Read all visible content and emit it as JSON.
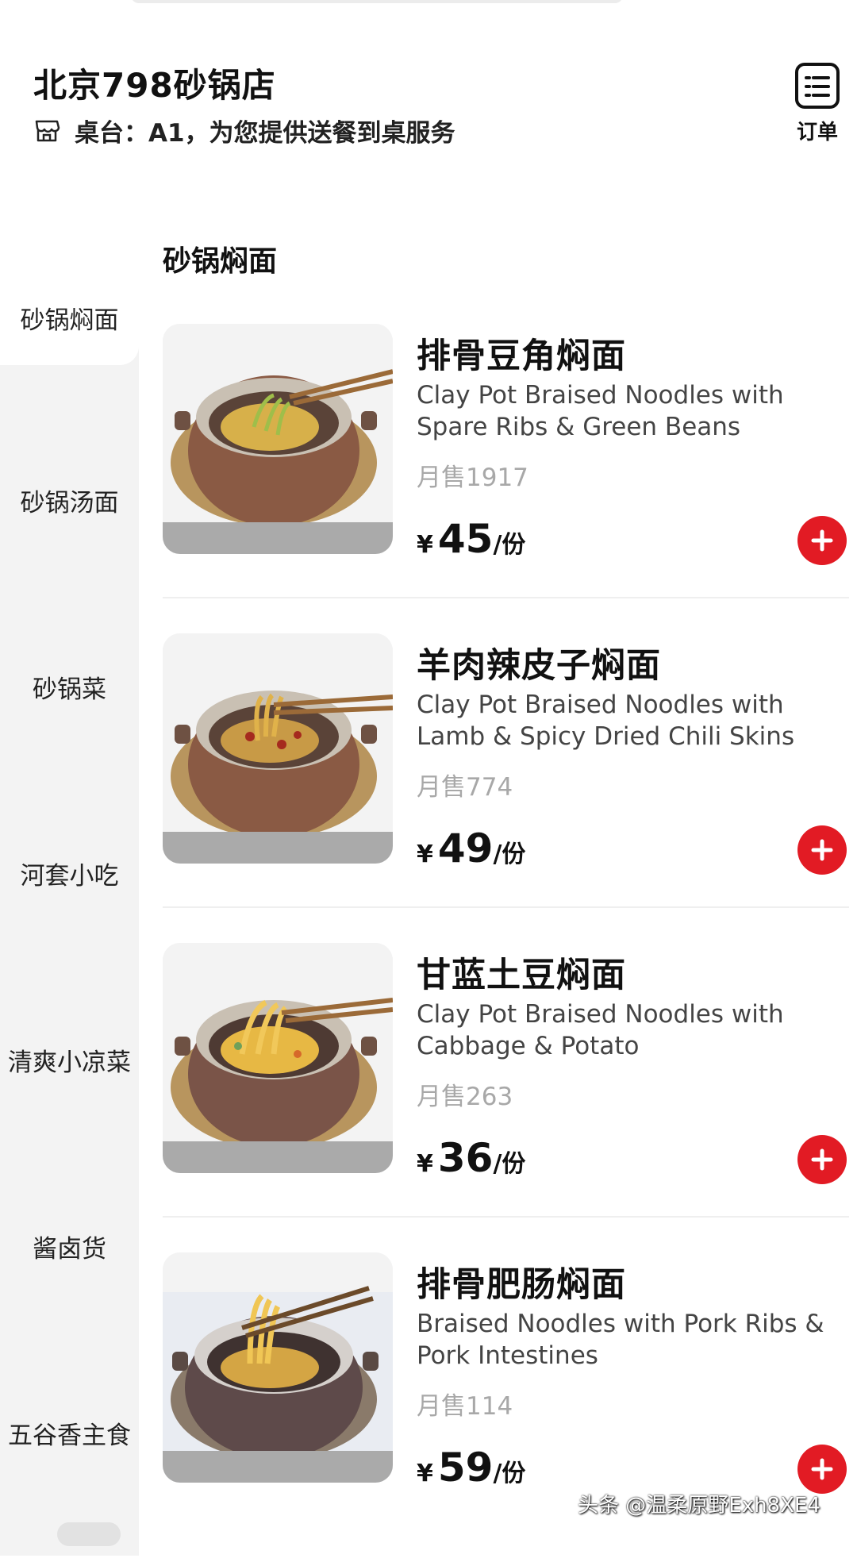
{
  "header": {
    "store_name": "北京798砂锅店",
    "table_info": "桌台：A1，为您提供送餐到桌服务",
    "orders_label": "订单"
  },
  "sidebar": {
    "items": [
      {
        "label": "砂锅焖面",
        "active": true
      },
      {
        "label": "砂锅汤面"
      },
      {
        "label": "砂锅菜"
      },
      {
        "label": "河套小吃"
      },
      {
        "label": "清爽小凉菜"
      },
      {
        "label": "酱卤货"
      },
      {
        "label": "五谷香主食"
      }
    ]
  },
  "section": {
    "title": "砂锅焖面"
  },
  "dishes": [
    {
      "name": "排骨豆角焖面",
      "name_en": "Clay Pot Braised Noodles with Spare Ribs & Green Beans",
      "sales": "月售1917",
      "currency": "¥",
      "price": "45",
      "unit": "/份"
    },
    {
      "name": "羊肉辣皮子焖面",
      "name_en": "Clay Pot Braised Noodles with Lamb & Spicy Dried Chili Skins",
      "sales": "月售774",
      "currency": "¥",
      "price": "49",
      "unit": "/份"
    },
    {
      "name": "甘蓝土豆焖面",
      "name_en": "Clay Pot Braised Noodles with Cabbage & Potato",
      "sales": "月售263",
      "currency": "¥",
      "price": "36",
      "unit": "/份"
    },
    {
      "name": "排骨肥肠焖面",
      "name_en": "Braised Noodles with Pork Ribs & Pork Intestines",
      "sales": "月售114",
      "currency": "¥",
      "price": "59",
      "unit": "/份"
    }
  ],
  "watermark": "头条 @温柔原野Exh8XE4",
  "colors": {
    "accent": "#e21b24",
    "sidebar_bg": "#f3f3f3",
    "sales_text": "#a8a8a8"
  },
  "icons": {
    "store": "store-icon",
    "orders": "order-list-icon",
    "add": "plus-icon"
  }
}
